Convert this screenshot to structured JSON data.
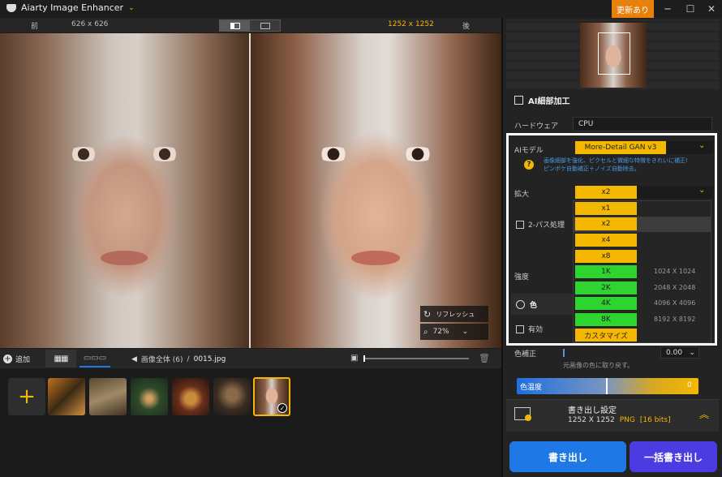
{
  "app": {
    "title": "Aiarty Image Enhancer",
    "update": "更新あり"
  },
  "compare": {
    "before": "前",
    "before_size": "626 x 626",
    "after_size": "1252 x 1252",
    "after": "後"
  },
  "overlay": {
    "refresh": "リフレッシュ",
    "zoom": "72%"
  },
  "bottombar": {
    "add": "追加",
    "crumb_all": "画像全体 (6)",
    "crumb_sep": "/",
    "crumb_file": "0015.jpg"
  },
  "panel": {
    "section": "AI細部加工",
    "hardware_label": "ハードウェア",
    "hardware_value": "CPU",
    "model_label": "AIモデル",
    "model_value": "More-Detail GAN  v3",
    "model_desc_1": "画像細部を強化、ピクセルと微細な特徴をきれいに補正!",
    "model_desc_2": "ピンボケ自動補正＋ノイズ自動除去。",
    "scale_label": "拡大",
    "scale_value": "x2",
    "twopass": "2-パス処理",
    "strength": "強度",
    "color": "色",
    "enable": "有効",
    "color_fix": "色補正",
    "color_fix_value": "0.00",
    "color_fix_hint": "元画像の色に取り戻す。",
    "temp_label": "色温度",
    "temp_value": "0",
    "export_title": "書き出し設定",
    "export_size": "1252 X 1252",
    "export_format": "PNG",
    "export_bits": "[16 bits]",
    "export_btn": "書き出し",
    "batch_btn": "一括書き出し"
  },
  "scale_options": [
    {
      "label": "x1",
      "res": ""
    },
    {
      "label": "x2",
      "res": ""
    },
    {
      "label": "x4",
      "res": ""
    },
    {
      "label": "x8",
      "res": ""
    },
    {
      "label": "1K",
      "res": "1024 X 1024"
    },
    {
      "label": "2K",
      "res": "2048 X 2048"
    },
    {
      "label": "4K",
      "res": "4096 X 4096"
    },
    {
      "label": "8K",
      "res": "8192 X 8192"
    },
    {
      "label": "カスタマイズ",
      "res": ""
    }
  ],
  "colors": {
    "accent": "#f5b800",
    "green": "#2ed52e",
    "orange": "#e8800c",
    "blue": "#1e78e6",
    "purple": "#4a3ce0"
  }
}
